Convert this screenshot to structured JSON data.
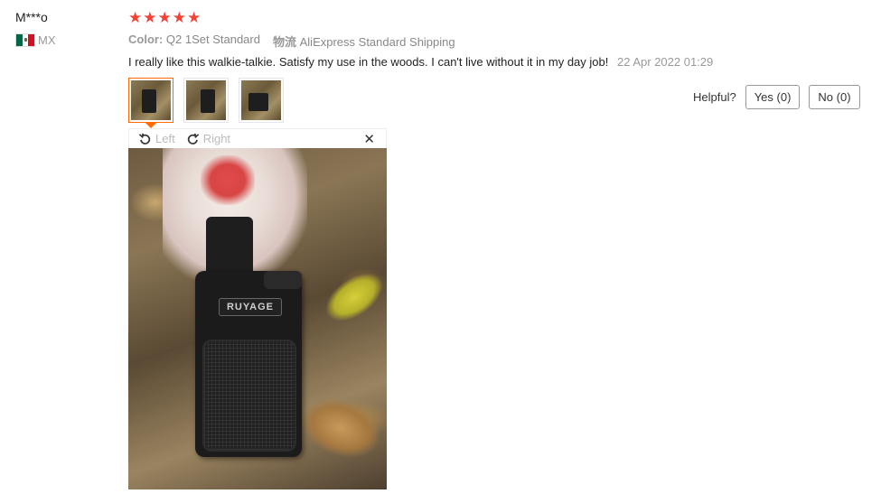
{
  "review": {
    "username": "M***o",
    "country_code": "MX",
    "rating": 5,
    "stars": [
      "★",
      "★",
      "★",
      "★",
      "★"
    ],
    "star_color": "#f44336",
    "attributes": {
      "color_label": "Color:",
      "color_value": "Q2 1Set Standard",
      "shipping_label": "物流",
      "shipping_value": "AliExpress Standard Shipping"
    },
    "text": "I really like this walkie-talkie. Satisfy my use in the woods. I can't live without it in my day job!",
    "date": "22 Apr 2022 01:29"
  },
  "thumbnails": [
    {
      "name": "photo-thumbnail-1",
      "active": true
    },
    {
      "name": "photo-thumbnail-2",
      "active": false
    },
    {
      "name": "photo-thumbnail-3",
      "active": false
    }
  ],
  "helpful": {
    "label": "Helpful?",
    "yes_label": "Yes (0)",
    "no_label": "No (0)"
  },
  "viewer": {
    "rotate_left_label": "Left",
    "rotate_right_label": "Right",
    "close_glyph": "✕",
    "brand_text": "RUYAGE"
  },
  "colors": {
    "accent": "#ff6a00",
    "flag_green": "#006847",
    "flag_red": "#ce1126"
  },
  "icons": [
    "mexico-flag-icon",
    "star-icon",
    "rotate-left-icon",
    "rotate-right-icon",
    "close-icon"
  ]
}
